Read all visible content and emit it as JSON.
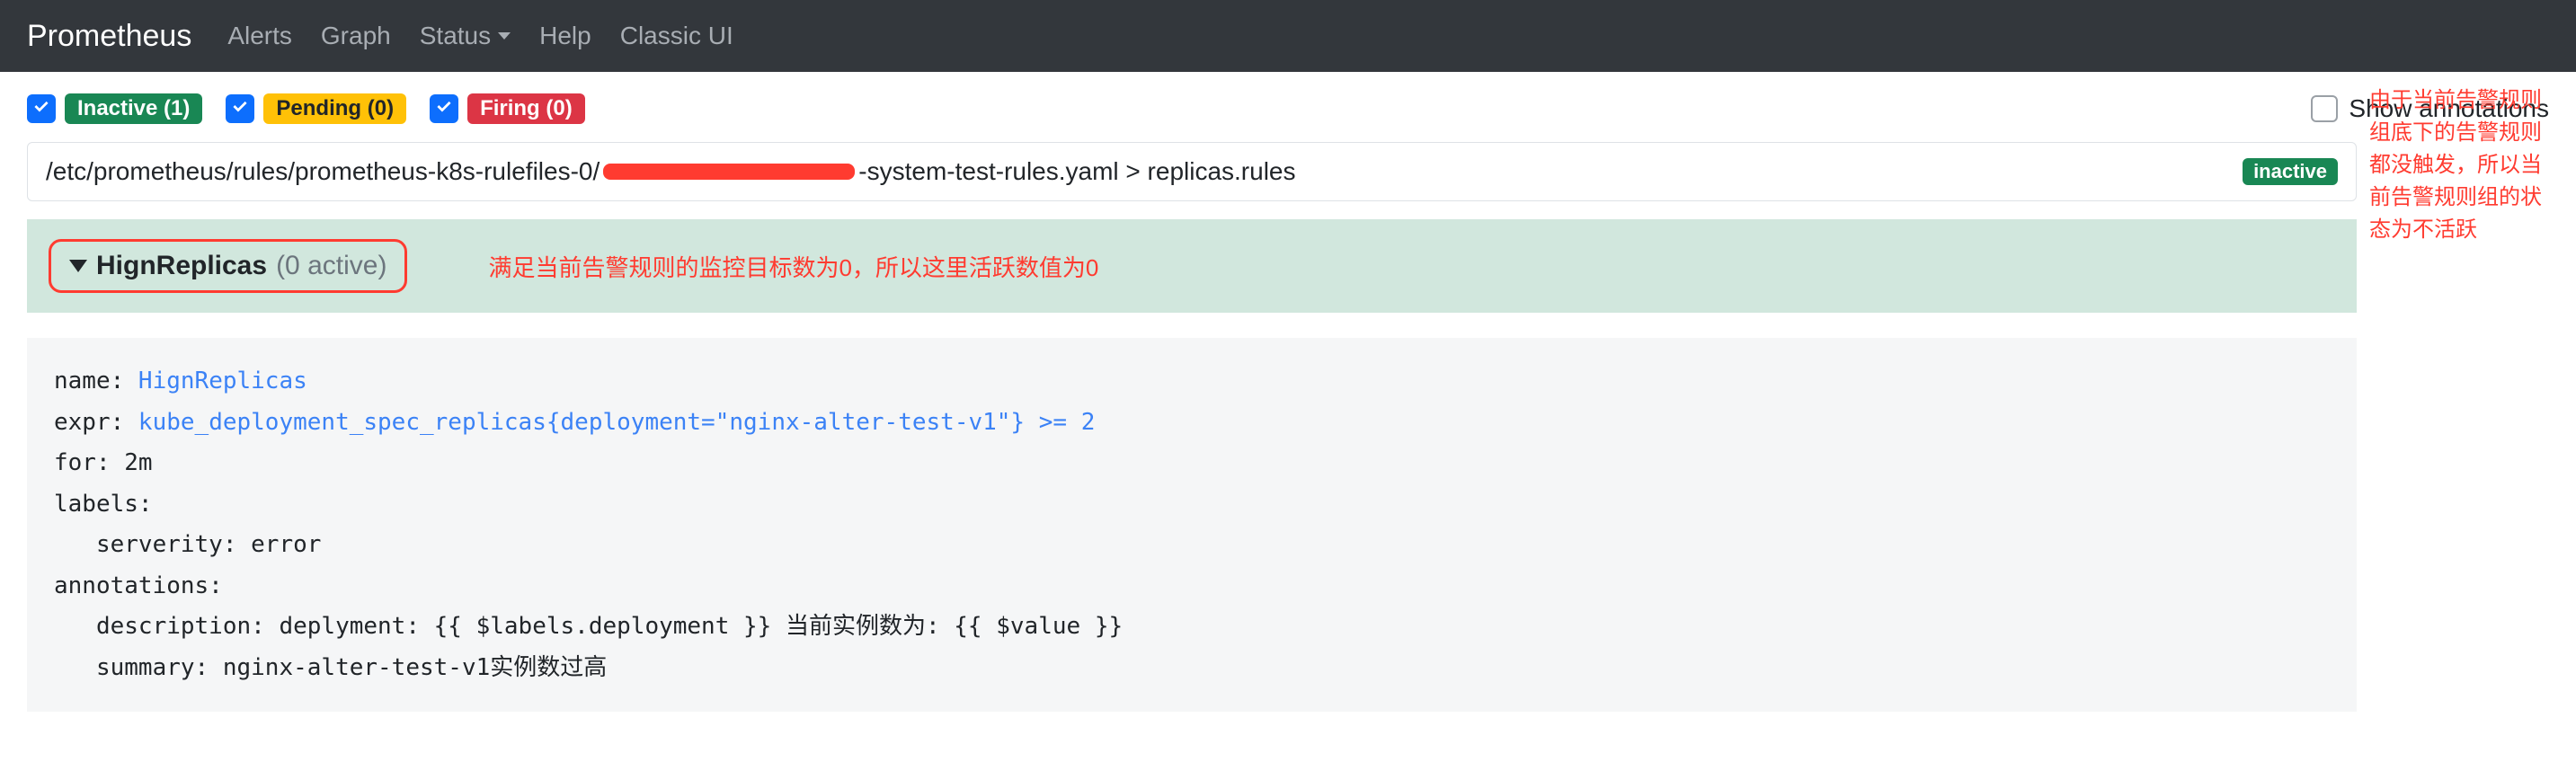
{
  "nav": {
    "brand": "Prometheus",
    "alerts": "Alerts",
    "graph": "Graph",
    "status": "Status",
    "help": "Help",
    "classic": "Classic UI"
  },
  "filters": {
    "inactive": "Inactive (1)",
    "pending": "Pending (0)",
    "firing": "Firing (0)",
    "show_annotations": "Show annotations"
  },
  "rule_file": {
    "prefix": "/etc/prometheus/rules/prometheus-k8s-rulefiles-0/",
    "suffix": "-system-test-rules.yaml > replicas.rules",
    "badge": "inactive"
  },
  "rule": {
    "name": "HignReplicas",
    "active": "(0 active)",
    "annotation": "满足当前告警规则的监控目标数为0，所以这里活跃数值为0"
  },
  "side_annotation": "由于当前告警规则组底下的告警规则都没触发，所以当前告警规则组的状态为不活跃",
  "code": {
    "l1_key": "name: ",
    "l1_val": "HignReplicas",
    "l2_key": "expr: ",
    "l2_val": "kube_deployment_spec_replicas{deployment=\"nginx-alter-test-v1\"} >= 2",
    "l3": "for: 2m",
    "l4": "labels:",
    "l5": "   serverity: error",
    "l6": "annotations:",
    "l7": "   description: deplyment: {{ $labels.deployment }} 当前实例数为: {{ $value }}",
    "l8": "   summary: nginx-alter-test-v1实例数过高"
  }
}
